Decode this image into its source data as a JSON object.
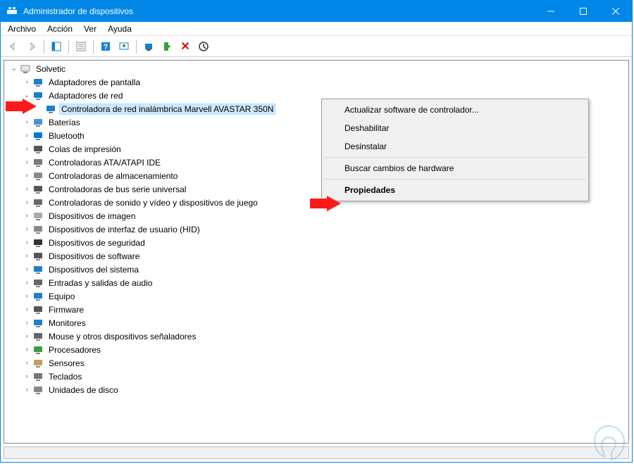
{
  "window": {
    "title": "Administrador de dispositivos"
  },
  "menu": {
    "items": [
      "Archivo",
      "Acción",
      "Ver",
      "Ayuda"
    ]
  },
  "tree": {
    "root": "Solvetic",
    "nodes": [
      {
        "label": "Adaptadores de pantalla",
        "expander": "›",
        "iconColor": "#1b7fcc"
      },
      {
        "label": "Adaptadores de red",
        "expander": "⌄",
        "iconColor": "#1b7fcc",
        "expanded": true,
        "children": [
          {
            "label": "Controladora de red inalámbrica Marvell AVASTAR 350N",
            "selected": true,
            "iconColor": "#1b7fcc"
          }
        ]
      },
      {
        "label": "Baterías",
        "expander": "›",
        "iconColor": "#4a90d9"
      },
      {
        "label": "Bluetooth",
        "expander": "›",
        "iconColor": "#0078d4"
      },
      {
        "label": "Colas de impresión",
        "expander": "›",
        "iconColor": "#555"
      },
      {
        "label": "Controladoras ATA/ATAPI IDE",
        "expander": "›",
        "iconColor": "#7a7a7a"
      },
      {
        "label": "Controladoras de almacenamiento",
        "expander": "›",
        "iconColor": "#8a8a8a"
      },
      {
        "label": "Controladoras de bus serie universal",
        "expander": "›",
        "iconColor": "#555"
      },
      {
        "label": "Controladoras de sonido y vídeo y dispositivos de juego",
        "expander": "›",
        "iconColor": "#6a6a6a"
      },
      {
        "label": "Dispositivos de imagen",
        "expander": "›",
        "iconColor": "#aaa"
      },
      {
        "label": "Dispositivos de interfaz de usuario (HID)",
        "expander": "›",
        "iconColor": "#888"
      },
      {
        "label": "Dispositivos de seguridad",
        "expander": "›",
        "iconColor": "#333"
      },
      {
        "label": "Dispositivos de software",
        "expander": "›",
        "iconColor": "#555"
      },
      {
        "label": "Dispositivos del sistema",
        "expander": "›",
        "iconColor": "#1b7fcc"
      },
      {
        "label": "Entradas y salidas de audio",
        "expander": "›",
        "iconColor": "#666"
      },
      {
        "label": "Equipo",
        "expander": "›",
        "iconColor": "#1b7fcc"
      },
      {
        "label": "Firmware",
        "expander": "›",
        "iconColor": "#555"
      },
      {
        "label": "Monitores",
        "expander": "›",
        "iconColor": "#1b7fcc"
      },
      {
        "label": "Mouse y otros dispositivos señaladores",
        "expander": "›",
        "iconColor": "#666"
      },
      {
        "label": "Procesadores",
        "expander": "›",
        "iconColor": "#3a9f3a"
      },
      {
        "label": "Sensores",
        "expander": "›",
        "iconColor": "#c0a060"
      },
      {
        "label": "Teclados",
        "expander": "›",
        "iconColor": "#777"
      },
      {
        "label": "Unidades de disco",
        "expander": "›",
        "iconColor": "#888"
      }
    ]
  },
  "contextMenu": {
    "items": [
      {
        "label": "Actualizar software de controlador...",
        "type": "item"
      },
      {
        "label": "Deshabilitar",
        "type": "item"
      },
      {
        "label": "Desinstalar",
        "type": "item"
      },
      {
        "type": "sep"
      },
      {
        "label": "Buscar cambios de hardware",
        "type": "item"
      },
      {
        "type": "sep"
      },
      {
        "label": "Propiedades",
        "type": "item",
        "bold": true
      }
    ]
  }
}
